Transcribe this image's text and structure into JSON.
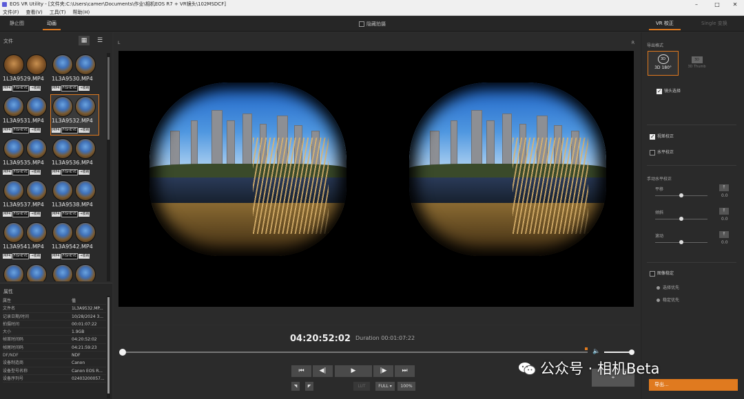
{
  "window": {
    "title": "EOS VR Utility - [文件夹:C:\\Users\\camer\\Documents\\作业\\相机EOS R7 + VR镜头\\102MSDCF]",
    "controls": [
      "–",
      "□",
      "✕"
    ]
  },
  "menu": [
    "文件(F)",
    "查看(V)",
    "工具(T)",
    "帮助(H)"
  ],
  "top_tabs": {
    "still": "静止图",
    "movie": "动画"
  },
  "show_still_label": "隐藏拍摄",
  "right_tabs": {
    "vr": "VR 校正",
    "single": "Single 变换"
  },
  "files": {
    "title": "文件",
    "items": [
      {
        "name": "1L3A9529.MP4",
        "tags": [
          "MP4",
          "FISHEYE",
          "→收纳"
        ]
      },
      {
        "name": "1L3A9530.MP4",
        "tags": [
          "MP4",
          "FISHEYE",
          "→收纳"
        ]
      },
      {
        "name": "1L3A9531.MP4",
        "tags": [
          "MP4",
          "FISHEYE",
          "→收纳"
        ]
      },
      {
        "name": "1L3A9532.MP4",
        "tags": [
          "MP4",
          "FISHEYE",
          "→收纳"
        ]
      },
      {
        "name": "1L3A9535.MP4",
        "tags": [
          "MP4",
          "FISHEYE",
          "→收纳"
        ]
      },
      {
        "name": "1L3A9536.MP4",
        "tags": [
          "MP4",
          "FISHEYE",
          "→收纳"
        ]
      },
      {
        "name": "1L3A9537.MP4",
        "tags": [
          "MP4",
          "FISHEYE",
          "→收纳"
        ]
      },
      {
        "name": "1L3A9538.MP4",
        "tags": [
          "MP4",
          "FISHEYE",
          "→收纳"
        ]
      },
      {
        "name": "1L3A9541.MP4",
        "tags": [
          "MP4",
          "FISHEYE",
          "→收纳"
        ]
      },
      {
        "name": "1L3A9542.MP4",
        "tags": [
          "MP4",
          "FISHEYE",
          "→收纳"
        ]
      },
      {
        "name": "",
        "tags": []
      },
      {
        "name": "",
        "tags": []
      }
    ]
  },
  "properties": {
    "title": "属性",
    "rows": [
      {
        "k": "属性",
        "v": "值"
      },
      {
        "k": "文件名",
        "v": "1L3A9532.MP..."
      },
      {
        "k": "记录日期/时间",
        "v": "10/28/2024 3..."
      },
      {
        "k": "拍摄时间",
        "v": "00:01:07:22"
      },
      {
        "k": "大小",
        "v": "1.9GB"
      },
      {
        "k": "帧首时间码",
        "v": "04:20:52:02"
      },
      {
        "k": "帧尾时间码",
        "v": "04:21:59:23"
      },
      {
        "k": "DF/NDF",
        "v": "NDF"
      },
      {
        "k": "设备制造商",
        "v": "Canon"
      },
      {
        "k": "设备型号名称",
        "v": "Canon EOS R..."
      },
      {
        "k": "设备序列号",
        "v": "02403200057..."
      }
    ]
  },
  "viewer": {
    "left": "L",
    "right": "R"
  },
  "transport": {
    "timecode": "04:20:52:02",
    "duration": "Duration 00:01:07:22",
    "buttons": [
      "⏮",
      "◀|",
      "▶",
      "|▶",
      "⏭"
    ],
    "lut": "LUT",
    "full": "FULL ▾",
    "zoom": "100%",
    "mark_in": "◥",
    "mark_out": "◤",
    "snapshot": "⌖"
  },
  "right": {
    "output_format_label": "导出格式",
    "fmt_3d180": "3D 180°",
    "fmt_3d180_icon": "3D",
    "fmt_3dth": "3D Thumb",
    "fmt_3dth_icon": "3D",
    "lens_select": "镜头选择",
    "parallax": "视差校正",
    "horizon": "水平校正",
    "manual_level": "手动水平校正",
    "sliders": [
      {
        "name": "平移",
        "value": "0.0",
        "pos": 0.5
      },
      {
        "name": "倾斜",
        "value": "0.0",
        "pos": 0.5
      },
      {
        "name": "滚动",
        "value": "0.0",
        "pos": 0.5
      }
    ],
    "stabilize": "图像稳定",
    "radio1": "选择优先",
    "radio2": "稳定优先",
    "export": "导出..."
  },
  "watermark": "公众号 · 相机Beta"
}
